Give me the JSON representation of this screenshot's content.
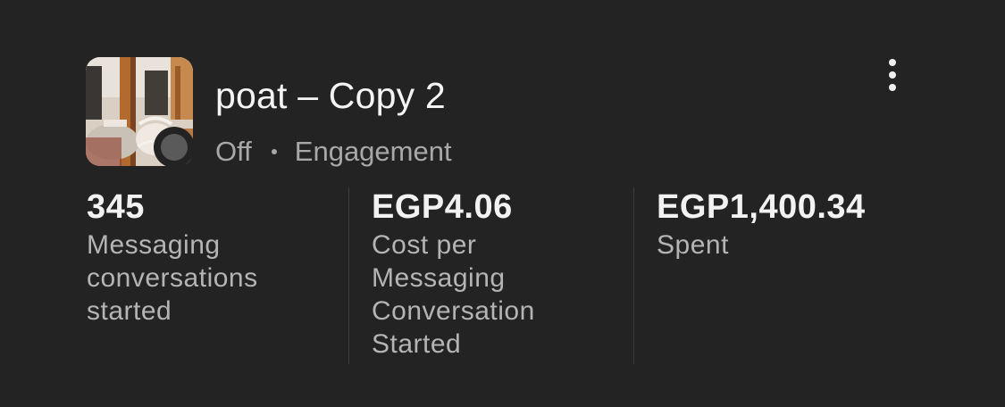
{
  "ad": {
    "name": "poat – Copy 2",
    "status": "Off",
    "objective": "Engagement"
  },
  "icons": {
    "status": "status-dot-icon",
    "more": "more-vertical-icon"
  },
  "colors": {
    "background": "#232323",
    "status_dot": "#5a5a5a"
  },
  "metrics": [
    {
      "value": "345",
      "label": "Messaging conversations started"
    },
    {
      "value": "EGP4.06",
      "label": "Cost per Messaging Conversation Started"
    },
    {
      "value": "EGP1,400.34",
      "label": "Spent"
    }
  ]
}
